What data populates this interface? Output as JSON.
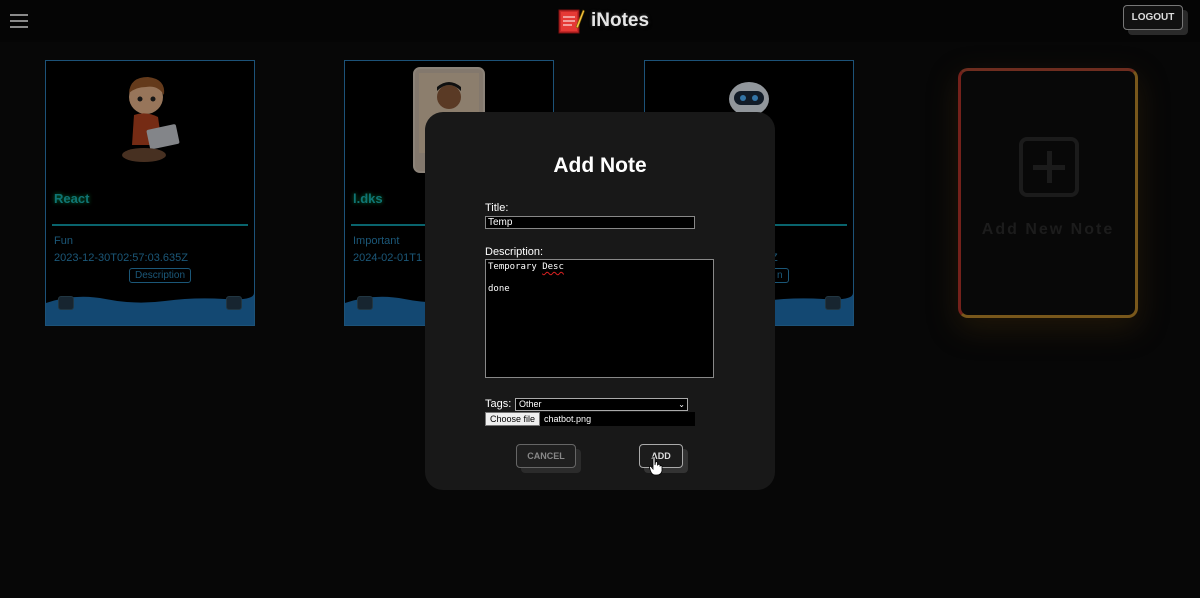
{
  "app": {
    "name": "iNotes",
    "logout_label": "LOGOUT"
  },
  "cards": [
    {
      "title": "React",
      "tag": "Fun",
      "date": "2023-12-30T02:57:03.635Z",
      "desc_label": "Description"
    },
    {
      "title": "l.dks",
      "tag": "Important",
      "date": "2024-02-01T1",
      "desc_label": ""
    },
    {
      "title": "",
      "tag": "",
      "date": "Z",
      "desc_label": "n"
    }
  ],
  "add_new": {
    "label": "Add New Note"
  },
  "modal": {
    "heading": "Add Note",
    "title_label": "Title:",
    "title_value": "Temp",
    "description_label": "Description:",
    "description_line1a": "Temporary ",
    "description_line1b": "Desc",
    "description_line2": "",
    "description_line3": "done",
    "tags_label": "Tags:",
    "tags_selected": "Other",
    "file_button": "Choose file",
    "file_name": "chatbot.png",
    "cancel_label": "CANCEL",
    "add_label": "ADD"
  },
  "colors": {
    "accent": "#2b7fb8",
    "title_teal": "#18b3b3",
    "add_gradient_start": "#c0392b",
    "add_gradient_end": "#d4a017"
  }
}
